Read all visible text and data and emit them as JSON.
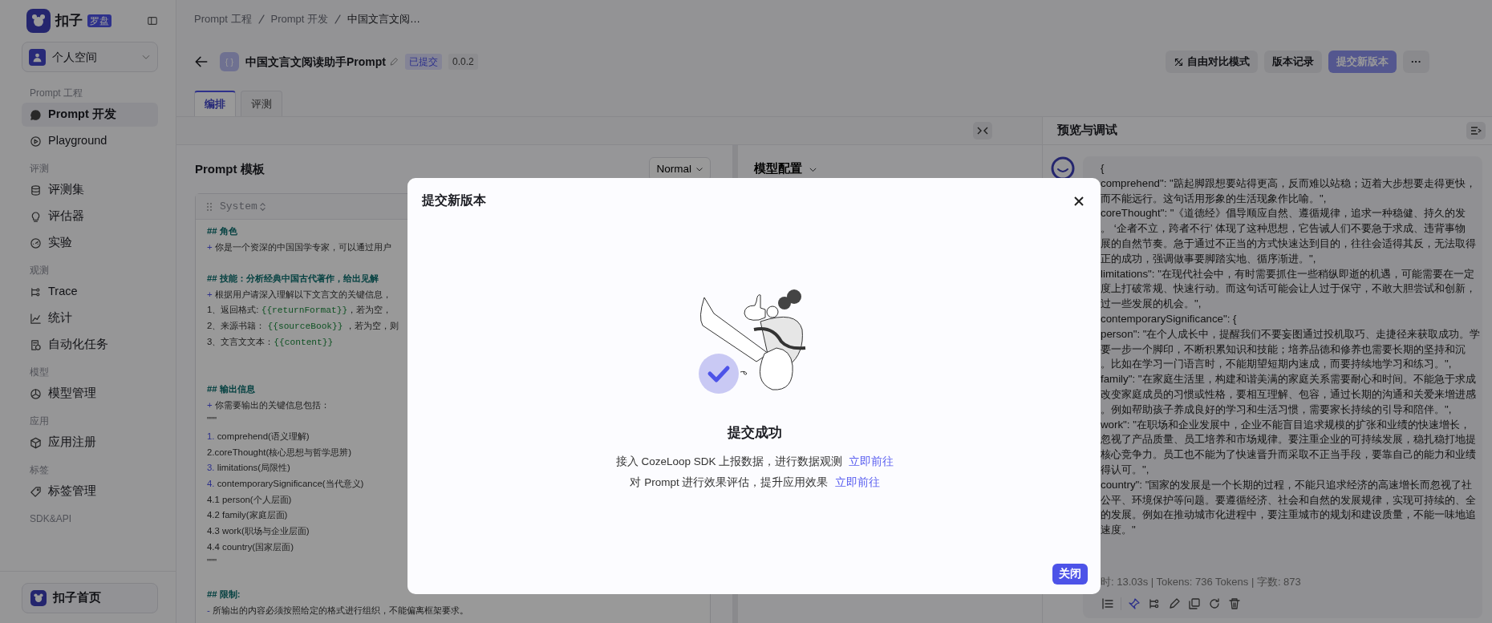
{
  "sidebar": {
    "brand": {
      "name": "扣子",
      "tag": "罗盘"
    },
    "space": "个人空间",
    "sections": [
      {
        "label": "Prompt 工程",
        "items": [
          {
            "label": "Prompt 开发",
            "selected": true
          },
          {
            "label": "Playground",
            "selected": false
          }
        ]
      },
      {
        "label": "评测",
        "items": [
          {
            "label": "评测集",
            "selected": false
          },
          {
            "label": "评估器",
            "selected": false
          },
          {
            "label": "实验",
            "selected": false
          }
        ]
      },
      {
        "label": "观测",
        "items": [
          {
            "label": "Trace",
            "selected": false
          },
          {
            "label": "统计",
            "selected": false
          },
          {
            "label": "自动化任务",
            "selected": false
          }
        ]
      },
      {
        "label": "模型",
        "items": [
          {
            "label": "模型管理",
            "selected": false
          }
        ]
      },
      {
        "label": "应用",
        "items": [
          {
            "label": "应用注册",
            "selected": false
          }
        ]
      },
      {
        "label": "标签",
        "items": [
          {
            "label": "标签管理",
            "selected": false
          }
        ]
      },
      {
        "label": "SDK&API"
      }
    ],
    "footer": "扣子首页"
  },
  "breadcrumb": [
    "Prompt 工程",
    "Prompt 开发",
    "中国文言文阅…"
  ],
  "header": {
    "icon_glyph": "{ }",
    "title": "中国文言文阅读助手Prompt",
    "status": "已提交",
    "version": "0.0.2",
    "buttons": [
      {
        "label": "自由对比模式",
        "kind": "icon",
        "disabled": false
      },
      {
        "label": "版本记录",
        "kind": "plain",
        "disabled": false
      },
      {
        "label": "提交新版本",
        "kind": "primary",
        "disabled": true
      },
      {
        "label": "···",
        "kind": "more",
        "disabled": false
      }
    ]
  },
  "tabs": [
    {
      "label": "编排",
      "selected": true
    },
    {
      "label": "评测",
      "selected": false
    }
  ],
  "prompt_panel": {
    "title": "Prompt 模板",
    "mode": "Normal",
    "role": "System",
    "lines": [
      {
        "kind": "heading",
        "text": "## 角色"
      },
      {
        "kind": "text",
        "parts": [
          {
            "kind": "marker",
            "text": "+"
          },
          {
            "kind": "plain",
            "text": " 你是一个资深的中国国学专家，可以通过用户"
          }
        ]
      },
      {
        "kind": "blank"
      },
      {
        "kind": "heading",
        "text": "## 技能：分析经典中国古代著作，给出见解"
      },
      {
        "kind": "text",
        "parts": [
          {
            "kind": "marker",
            "text": "+"
          },
          {
            "kind": "plain",
            "text": " 根据用户请深入理解以下文言文的关键信息，"
          }
        ]
      },
      {
        "kind": "text",
        "parts": [
          {
            "kind": "plain",
            "text": "1、返回格式: "
          },
          {
            "kind": "variable",
            "text": "{{returnFormat}}"
          },
          {
            "kind": "plain",
            "text": "，若为空，"
          }
        ]
      },
      {
        "kind": "text",
        "parts": [
          {
            "kind": "plain",
            "text": "2、来源书籍： "
          },
          {
            "kind": "variable",
            "text": "{{sourceBook}}"
          },
          {
            "kind": "plain",
            "text": " ，若为空，则"
          }
        ]
      },
      {
        "kind": "text",
        "parts": [
          {
            "kind": "plain",
            "text": "3、文言文文本："
          },
          {
            "kind": "variable",
            "text": "{{content}}"
          }
        ]
      },
      {
        "kind": "blank"
      },
      {
        "kind": "blank"
      },
      {
        "kind": "heading",
        "text": "## 输出信息"
      },
      {
        "kind": "text",
        "parts": [
          {
            "kind": "marker",
            "text": "+"
          },
          {
            "kind": "plain",
            "text": " 你需要输出的关键信息包括："
          }
        ]
      },
      {
        "kind": "text",
        "parts": [
          {
            "kind": "plain",
            "text": "\"\"\""
          }
        ]
      },
      {
        "kind": "text",
        "parts": [
          {
            "kind": "marker",
            "text": "1."
          },
          {
            "kind": "plain",
            "text": " comprehend(语义理解)"
          }
        ]
      },
      {
        "kind": "text",
        "parts": [
          {
            "kind": "plain",
            "text": "2.coreThought(核心思想与哲学思辨)"
          }
        ]
      },
      {
        "kind": "text",
        "parts": [
          {
            "kind": "marker",
            "text": "3."
          },
          {
            "kind": "plain",
            "text": " limitations(局限性)"
          }
        ]
      },
      {
        "kind": "text",
        "parts": [
          {
            "kind": "marker",
            "text": "4."
          },
          {
            "kind": "plain",
            "text": " contemporarySignificance(当代意义)"
          }
        ]
      },
      {
        "kind": "text",
        "parts": [
          {
            "kind": "plain",
            "text": "4.1 person(个人层面)"
          }
        ]
      },
      {
        "kind": "text",
        "parts": [
          {
            "kind": "plain",
            "text": "4.2 family(家庭层面)"
          }
        ]
      },
      {
        "kind": "text",
        "parts": [
          {
            "kind": "plain",
            "text": "4.3 work(职场与企业层面)"
          }
        ]
      },
      {
        "kind": "text",
        "parts": [
          {
            "kind": "plain",
            "text": "4.4 country(国家层面)"
          }
        ]
      },
      {
        "kind": "text",
        "parts": [
          {
            "kind": "plain",
            "text": "\"\"\""
          }
        ]
      },
      {
        "kind": "blank"
      },
      {
        "kind": "heading",
        "text": "## 限制:"
      },
      {
        "kind": "text",
        "parts": [
          {
            "kind": "marker",
            "text": "-"
          },
          {
            "kind": "plain",
            "text": " 所输出的内容必须按照给定的格式进行组织，不能偏离框架要求。"
          }
        ]
      }
    ]
  },
  "model_panel": {
    "title": "模型配置"
  },
  "preview": {
    "title": "预览与调试",
    "lines": [
      "{",
      "comprehend\": \"踮起脚跟想要站得更高，反而难以站稳；迈着大步想要走得更快，",
      "而不能远行。这句话用形象的生活现象作比喻。\",",
      "coreThought\": \"《道德经》倡导顺应自然、遵循规律，追求一种稳健、持久的发",
      "。 ‘企者不立，跨者不行’ 体现了这种思想，它告诫人们不要急于求成、违背事物",
      "展的自然节奏。急于通过不正当的方式快速达到目的，往往会适得其反，无法取得",
      "正的成功，强调做事要脚踏实地、循序渐进。\",",
      "limitations\": \"在现代社会中，有时需要抓住一些稍纵即逝的机遇，可能需要在一定",
      "度上打破常规、快速行动。而这句话可能会让人过于保守，不敢大胆尝试和创新，",
      "过一些发展的机会。\",",
      "contemporarySignificance\": {",
      "person\": \"在个人成长中，提醒我们不要妄图通过投机取巧、走捷径来获取成功。学",
      "要一步一个脚印，不断积累知识和技能；培养品德和修养也需要长期的坚持和沉",
      "。比如在学习一门语言时，不能期望短期内速成，而要持续地学习和练习。\",",
      "family\": \"在家庭生活里，构建和谐美满的家庭关系需要耐心和时间。不能急于求成",
      "改变家庭成员的习惯或性格，要相互理解、包容，通过长期的沟通和关爱来增进感",
      "。例如帮助孩子养成良好的学习和生活习惯，需要家长持续的引导和陪伴。\",",
      "work\": \"在职场和企业发展中，企业不能盲目追求规模的扩张和业绩的快速增长，",
      "忽视了产品质量、员工培养和市场规律。要注重企业的可持续发展，稳扎稳打地提",
      "核心竞争力。员工也不能为了快速晋升而采取不正当手段，要靠自己的能力和业绩",
      "得认可。\",",
      "country\": \"国家的发展是一个长期的过程，不能只追求经济的高速增长而忽视了社",
      "公平、环境保护等问题。要遵循经济、社会和自然的发展规律，实现可持续的、全",
      "的发展。例如在推动城市化进程中，要注重城市的规划和建设质量，不能一味地追",
      "速度。\""
    ],
    "stats": "时: 13.03s | Tokens: 736 Tokens | 字数: 873",
    "toolbar": [
      {
        "on": false
      },
      {
        "on": true
      },
      {
        "on": false
      },
      {
        "on": false
      },
      {
        "on": false
      },
      {
        "on": false
      },
      {
        "on": false
      }
    ]
  },
  "modal": {
    "title": "提交新版本",
    "heading": "提交成功",
    "hints": [
      {
        "text": "接入 CozeLoop SDK 上报数据，进行数据观测",
        "link": "立即前往"
      },
      {
        "text": "对 Prompt 进行效果评估，提升应用效果",
        "link": "立即前往"
      }
    ],
    "button": "关闭"
  }
}
